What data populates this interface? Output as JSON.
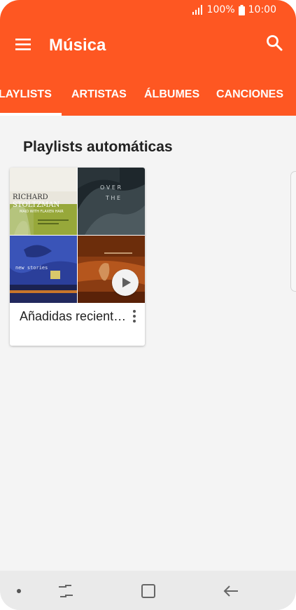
{
  "status_bar": {
    "battery_percent": "100%",
    "time": "10:00"
  },
  "toolbar": {
    "title": "Música",
    "icons": [
      "menu-icon",
      "search-icon"
    ]
  },
  "tabs": [
    {
      "label": "LAYLISTS",
      "selected": true
    },
    {
      "label": "ARTISTAS",
      "selected": false
    },
    {
      "label": "ÁLBUMES",
      "selected": false
    },
    {
      "label": "CANCIONES",
      "selected": false
    }
  ],
  "section": {
    "title": "Playlists automáticas"
  },
  "playlist_card": {
    "title": "Añadidas recient…",
    "cover_art": [
      {
        "lines": [
          "RICHARD",
          "STOLTZMAN",
          "MAID WITH FLAXEN HAIR"
        ]
      },
      {
        "lines": [
          "O V E R",
          "T H E"
        ]
      },
      {
        "lines": [
          "new stories"
        ]
      },
      {
        "lines": []
      }
    ]
  },
  "colors": {
    "accent": "#fe5722",
    "background": "#f4f4f4",
    "text": "#212121"
  }
}
